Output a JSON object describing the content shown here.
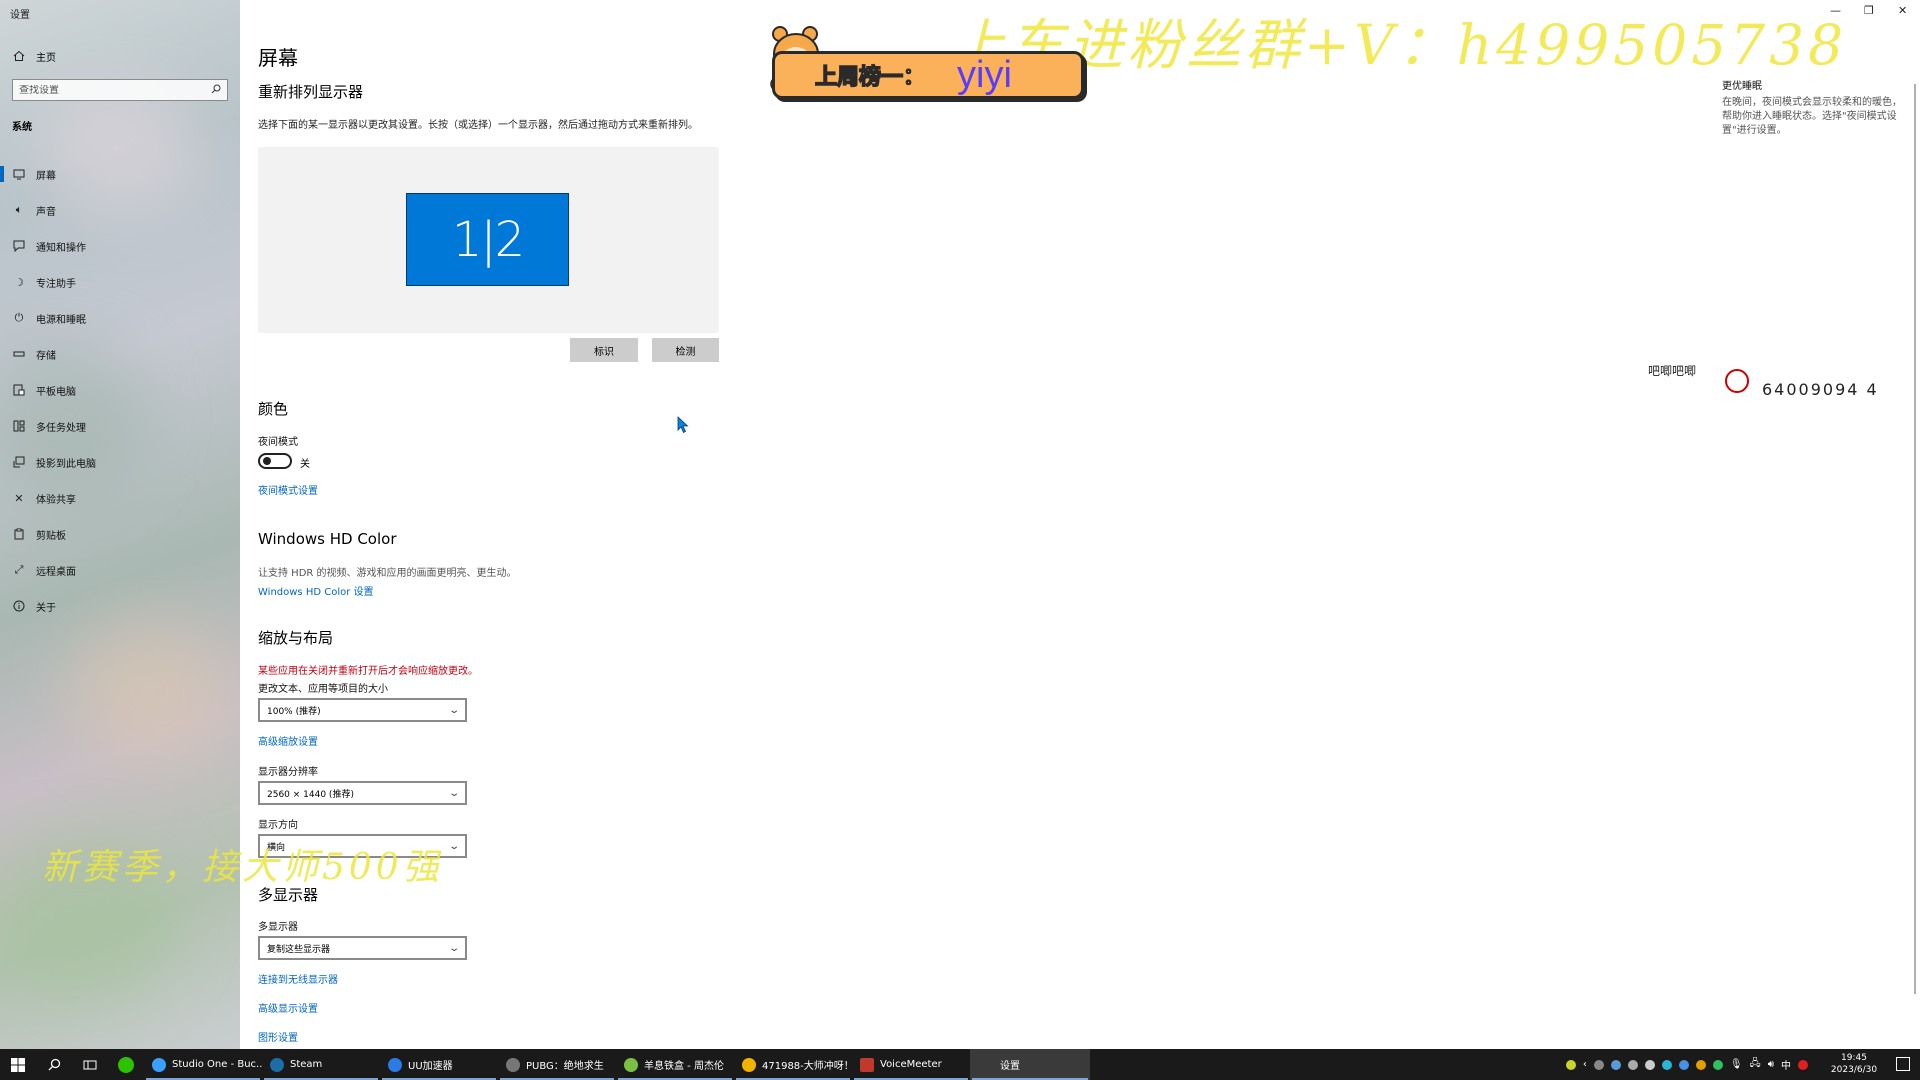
{
  "window": {
    "app_title": "设置",
    "minimize": "—",
    "restore": "❐",
    "close": "✕"
  },
  "sidebar": {
    "home_label": "主页",
    "search_placeholder": "查找设置",
    "section": "系统",
    "items": [
      {
        "label": "屏幕",
        "icon": "monitor-icon",
        "active": true
      },
      {
        "label": "声音",
        "icon": "speaker-icon"
      },
      {
        "label": "通知和操作",
        "icon": "notification-icon"
      },
      {
        "label": "专注助手",
        "icon": "moon-icon"
      },
      {
        "label": "电源和睡眠",
        "icon": "power-icon"
      },
      {
        "label": "存储",
        "icon": "storage-icon"
      },
      {
        "label": "平板电脑",
        "icon": "tablet-icon"
      },
      {
        "label": "多任务处理",
        "icon": "multitask-icon"
      },
      {
        "label": "投影到此电脑",
        "icon": "project-icon"
      },
      {
        "label": "体验共享",
        "icon": "share-icon"
      },
      {
        "label": "剪贴板",
        "icon": "clipboard-icon"
      },
      {
        "label": "远程桌面",
        "icon": "remote-icon"
      },
      {
        "label": "关于",
        "icon": "info-icon"
      }
    ]
  },
  "main": {
    "title": "屏幕",
    "rearrange_heading": "重新排列显示器",
    "rearrange_desc": "选择下面的某一显示器以更改其设置。长按（或选择）一个显示器，然后通过拖动方式来重新排列。",
    "monitor_label": "1|2",
    "identify_button": "标识",
    "detect_button": "检测",
    "color_heading": "颜色",
    "night_mode_label": "夜间模式",
    "night_mode_state": "关",
    "night_mode_link": "夜间模式设置",
    "hd_heading": "Windows HD Color",
    "hd_desc": "让支持 HDR 的视频、游戏和应用的画面更明亮、更生动。",
    "hd_link": "Windows HD Color 设置",
    "scale_heading": "缩放与布局",
    "scale_warning": "某些应用在关闭并重新打开后才会响应缩放更改。",
    "scale_label": "更改文本、应用等项目的大小",
    "scale_value": "100% (推荐)",
    "advanced_scale_link": "高级缩放设置",
    "resolution_label": "显示器分辨率",
    "resolution_value": "2560 × 1440 (推荐)",
    "orientation_label": "显示方向",
    "orientation_value": "横向",
    "multi_heading": "多显示器",
    "multi_label": "多显示器",
    "multi_value": "复制这些显示器",
    "wireless_link": "连接到无线显示器",
    "advanced_display_link": "高级显示设置",
    "graphics_link": "图形设置"
  },
  "side_tip": {
    "title": "更优睡眠",
    "text": "在晚间，夜间模式会显示较柔和的暖色，帮助你进入睡眠状态。选择\"夜间模式设置\"进行设置。"
  },
  "overlay": {
    "top_text": "上车进粉丝群+V：h499505738",
    "bottom_text": "新赛季，接大师500强",
    "banner_label": "上周榜一：",
    "banner_name": "yiyi",
    "stamp_text": "吧唧吧唧",
    "stamp_number": "64009094 4"
  },
  "taskbar": {
    "apps": [
      {
        "label": "Studio One - Buc...",
        "color": "#3aa0ff"
      },
      {
        "label": "Steam",
        "color": "#1b6ea8"
      },
      {
        "label": "UU加速器",
        "color": "#2c7be5"
      },
      {
        "label": "PUBG：绝地求生",
        "color": "#777777"
      },
      {
        "label": "羊息铁盒 - 周杰伦",
        "color": "#7bc043"
      },
      {
        "label": "471988-大师冲呀！",
        "color": "#f0b400"
      },
      {
        "label": "VoiceMeeter",
        "color": "#c0392b"
      },
      {
        "label": "设置",
        "color": "#3a3a3a"
      }
    ],
    "ime": "中",
    "time": "19:45",
    "date": "2023/6/30"
  },
  "colors": {
    "accent": "#0067c0",
    "monitor_blue": "#0078d7",
    "warning_red": "#c00010",
    "overlay_yellow": "#f0e63c"
  }
}
